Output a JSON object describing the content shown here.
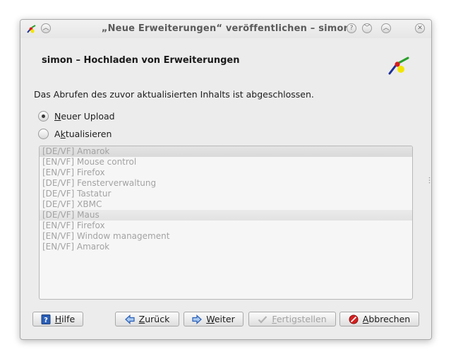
{
  "window": {
    "title": "„Neue Erweiterungen“ veröffentlichen – simon"
  },
  "header": {
    "title": "simon – Hochladen von Erweiterungen"
  },
  "status": "Das Abrufen des zuvor aktualisierten Inhalts ist abgeschlossen.",
  "options": [
    {
      "label_prefix": "",
      "accel": "N",
      "label_rest": "euer Upload",
      "checked": true
    },
    {
      "label_prefix": "A",
      "accel": "k",
      "label_rest": "tualisieren",
      "checked": false
    }
  ],
  "list": {
    "items": [
      "[DE/VF] Amarok",
      "[EN/VF] Mouse control",
      "[EN/VF] Firefox",
      "[DE/VF] Fensterverwaltung",
      "[DE/VF] Tastatur",
      "[DE/VF] XBMC",
      "[DE/VF] Maus",
      "[EN/VF] Firefox",
      "[EN/VF] Window management",
      "[EN/VF] Amarok"
    ]
  },
  "buttons": {
    "help": {
      "accel": "H",
      "rest": "ilfe"
    },
    "back": {
      "accel": "Z",
      "rest": "urück"
    },
    "next": {
      "accel": "W",
      "rest": "eiter"
    },
    "finish": {
      "accel": "F",
      "rest": "ertigstellen"
    },
    "cancel": {
      "accel": "A",
      "rest": "bbrechen"
    }
  },
  "colors": {
    "logo_green": "#2aa02a",
    "logo_red": "#d81e1e",
    "logo_blue": "#1c2f9a",
    "logo_yellow": "#f2e600",
    "cancel_red": "#d42020",
    "arrow_blue": "#2a5fb8"
  }
}
